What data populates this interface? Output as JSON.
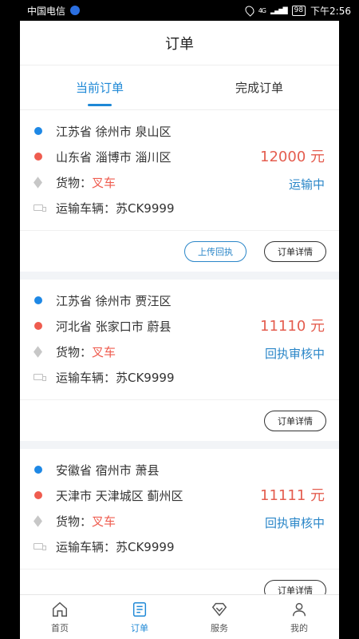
{
  "status_bar": {
    "carrier": "中国电信",
    "network": "4G",
    "battery": "98",
    "time": "下午2:56"
  },
  "header": {
    "title": "订单"
  },
  "tabs": [
    {
      "label": "当前订单",
      "active": true
    },
    {
      "label": "完成订单",
      "active": false
    }
  ],
  "orders": [
    {
      "origin": "江苏省 徐州市 泉山区",
      "destination": "山东省 淄博市 淄川区",
      "cargo_label": "货物：",
      "cargo": "叉车",
      "vehicle": "运输车辆：苏CK9999",
      "price": "12000 元",
      "status": "运输中",
      "upload_label": "上传回执",
      "detail_label": "订单详情"
    },
    {
      "origin": "江苏省 徐州市 贾汪区",
      "destination": "河北省 张家口市 蔚县",
      "cargo_label": "货物：",
      "cargo": "叉车",
      "vehicle": "运输车辆：苏CK9999",
      "price": "11110 元",
      "status": "回执审核中",
      "detail_label": "订单详情"
    },
    {
      "origin": "安徽省 宿州市 萧县",
      "destination": "天津市 天津城区 蓟州区",
      "cargo_label": "货物：",
      "cargo": "叉车",
      "vehicle": "运输车辆：苏CK9999",
      "price": "11111 元",
      "status": "回执审核中",
      "detail_label": "订单详情"
    }
  ],
  "bottom_nav": [
    {
      "label": "首页",
      "icon": "home-icon",
      "active": false
    },
    {
      "label": "订单",
      "icon": "order-icon",
      "active": true
    },
    {
      "label": "服务",
      "icon": "service-icon",
      "active": false
    },
    {
      "label": "我的",
      "icon": "profile-icon",
      "active": false
    }
  ],
  "colors": {
    "accent": "#1e88d6",
    "price": "#e45d4f",
    "cargo": "#ef5c4f",
    "status": "#2a86c8"
  }
}
